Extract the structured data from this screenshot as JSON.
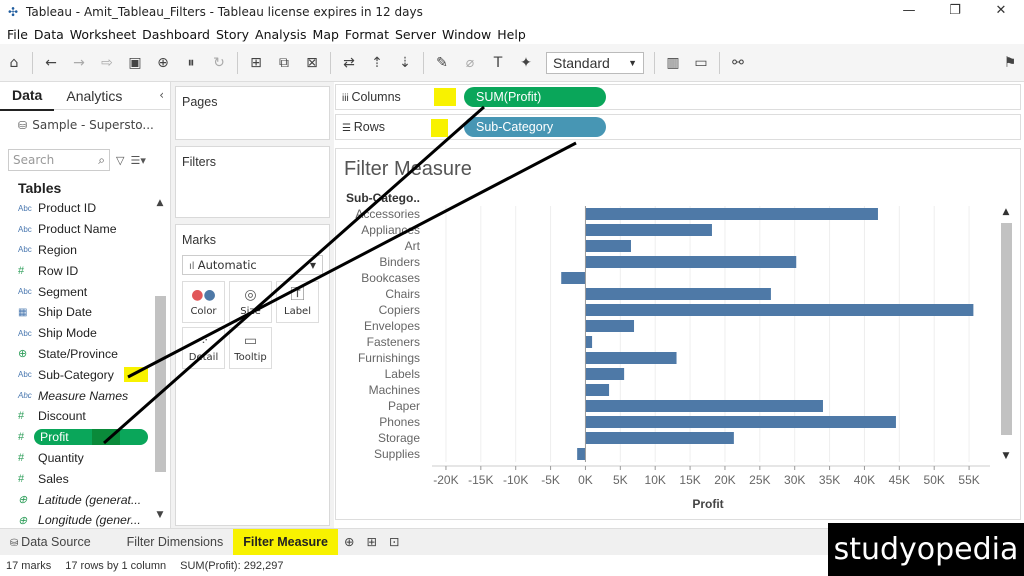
{
  "window": {
    "title": "Tableau - Amit_Tableau_Filters - Tableau license expires in 12 days"
  },
  "menu": [
    "File",
    "Data",
    "Worksheet",
    "Dashboard",
    "Story",
    "Analysis",
    "Map",
    "Format",
    "Server",
    "Window",
    "Help"
  ],
  "toolbar": {
    "fit_select": "Standard"
  },
  "left_panel": {
    "tab_data": "Data",
    "tab_analytics": "Analytics",
    "datasource": "Sample - Supersto...",
    "search_placeholder": "Search",
    "tables_heading": "Tables",
    "fields": [
      {
        "name": "Product ID",
        "type": "Abc"
      },
      {
        "name": "Product Name",
        "type": "Abc"
      },
      {
        "name": "Region",
        "type": "Abc"
      },
      {
        "name": "Row ID",
        "type": "#"
      },
      {
        "name": "Segment",
        "type": "Abc"
      },
      {
        "name": "Ship Date",
        "type": "date"
      },
      {
        "name": "Ship Mode",
        "type": "Abc"
      },
      {
        "name": "State/Province",
        "type": "geo"
      },
      {
        "name": "Sub-Category",
        "type": "Abc"
      },
      {
        "name": "Measure Names",
        "type": "Abc"
      },
      {
        "name": "Discount",
        "type": "#"
      },
      {
        "name": "Profit",
        "type": "#"
      },
      {
        "name": "Quantity",
        "type": "#"
      },
      {
        "name": "Sales",
        "type": "#"
      },
      {
        "name": "Latitude (generat...",
        "type": "geo"
      },
      {
        "name": "Longitude (gener...",
        "type": "geo"
      }
    ]
  },
  "shelves": {
    "pages": "Pages",
    "filters": "Filters",
    "marks": "Marks",
    "mark_type": "Automatic",
    "mark_buttons": [
      "Color",
      "Size",
      "Label",
      "Detail",
      "Tooltip"
    ],
    "columns_label": "Columns",
    "rows_label": "Rows",
    "columns_pill": "SUM(Profit)",
    "rows_pill": "Sub-Category"
  },
  "colors": {
    "bar": "#4e79a7",
    "measure_pill": "#0aa65a",
    "dimension_pill": "#4796b4",
    "highlight": "#f8f200"
  },
  "view": {
    "title": "Filter Measure",
    "row_header": "Sub-Catego.."
  },
  "chart_data": {
    "type": "bar",
    "orientation": "horizontal",
    "categories": [
      "Accessories",
      "Appliances",
      "Art",
      "Binders",
      "Bookcases",
      "Chairs",
      "Copiers",
      "Envelopes",
      "Fasteners",
      "Furnishings",
      "Labels",
      "Machines",
      "Paper",
      "Phones",
      "Storage",
      "Supplies"
    ],
    "values": [
      41937,
      18138,
      6528,
      30222,
      -3473,
      26590,
      55618,
      6964,
      950,
      13059,
      5546,
      3385,
      34054,
      44516,
      21279,
      -1189
    ],
    "xlabel": "Profit",
    "xlim": [
      -22000,
      58000
    ],
    "xticks": [
      "-20K",
      "-15K",
      "-10K",
      "-5K",
      "0K",
      "5K",
      "10K",
      "15K",
      "20K",
      "25K",
      "30K",
      "35K",
      "40K",
      "45K",
      "50K",
      "55K"
    ],
    "xtick_values": [
      -20000,
      -15000,
      -10000,
      -5000,
      0,
      5000,
      10000,
      15000,
      20000,
      25000,
      30000,
      35000,
      40000,
      45000,
      50000,
      55000
    ],
    "grid": true
  },
  "sheets": {
    "data_source": "Data Source",
    "tabs": [
      "Filter Dimensions",
      "Filter Measure"
    ]
  },
  "status": {
    "marks": "17 marks",
    "dims": "17 rows by 1 column",
    "sum": "SUM(Profit): 292,297"
  },
  "brand": "studyopedia"
}
